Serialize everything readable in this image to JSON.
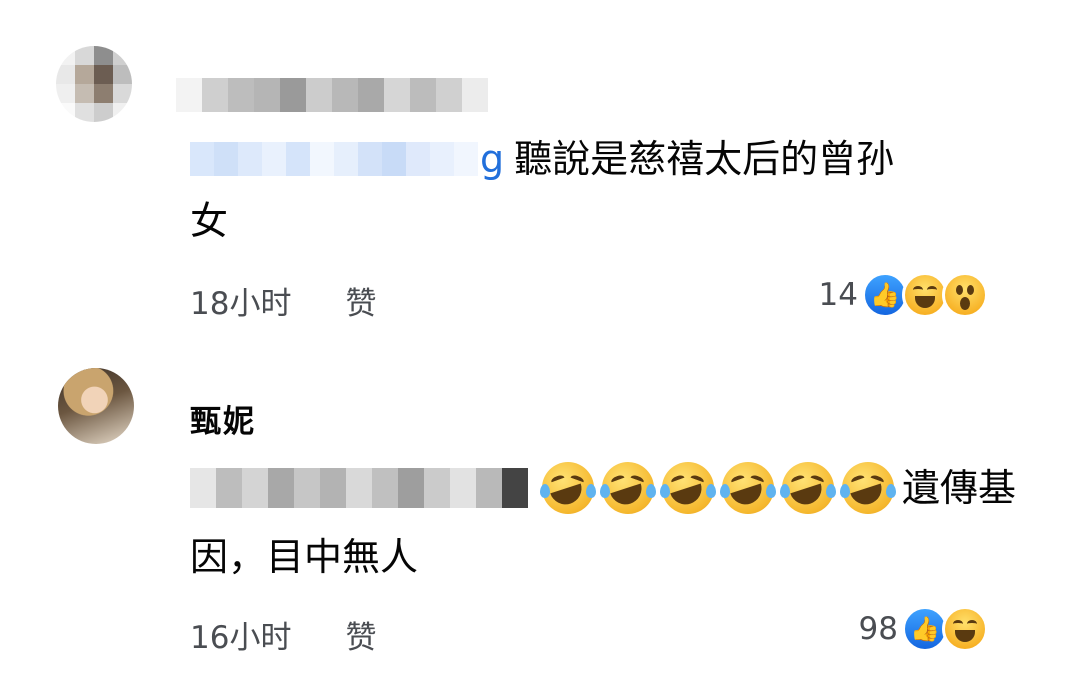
{
  "comments": [
    {
      "author": "",
      "mention_suffix": "g",
      "text_line1": "聽說是慈禧太后的曾孙",
      "text_line2": "女",
      "time": "18小时",
      "like_action": "赞",
      "reaction_count": "14",
      "reactions": [
        "like-icon",
        "haha-icon",
        "wow-icon"
      ]
    },
    {
      "author": "甄妮",
      "text_line1_tail": "遺傳基",
      "text_line2": "因，目中無人",
      "emoji_count": 6,
      "emoji": "rolling-on-floor-laughing-icon",
      "time": "16小时",
      "like_action": "赞",
      "reaction_count": "98",
      "reactions": [
        "like-icon",
        "haha-icon"
      ]
    }
  ],
  "colors": {
    "mention_blue": "#216fdb",
    "meta_gray": "#4a4d52",
    "like_blue": "#1877f2"
  }
}
